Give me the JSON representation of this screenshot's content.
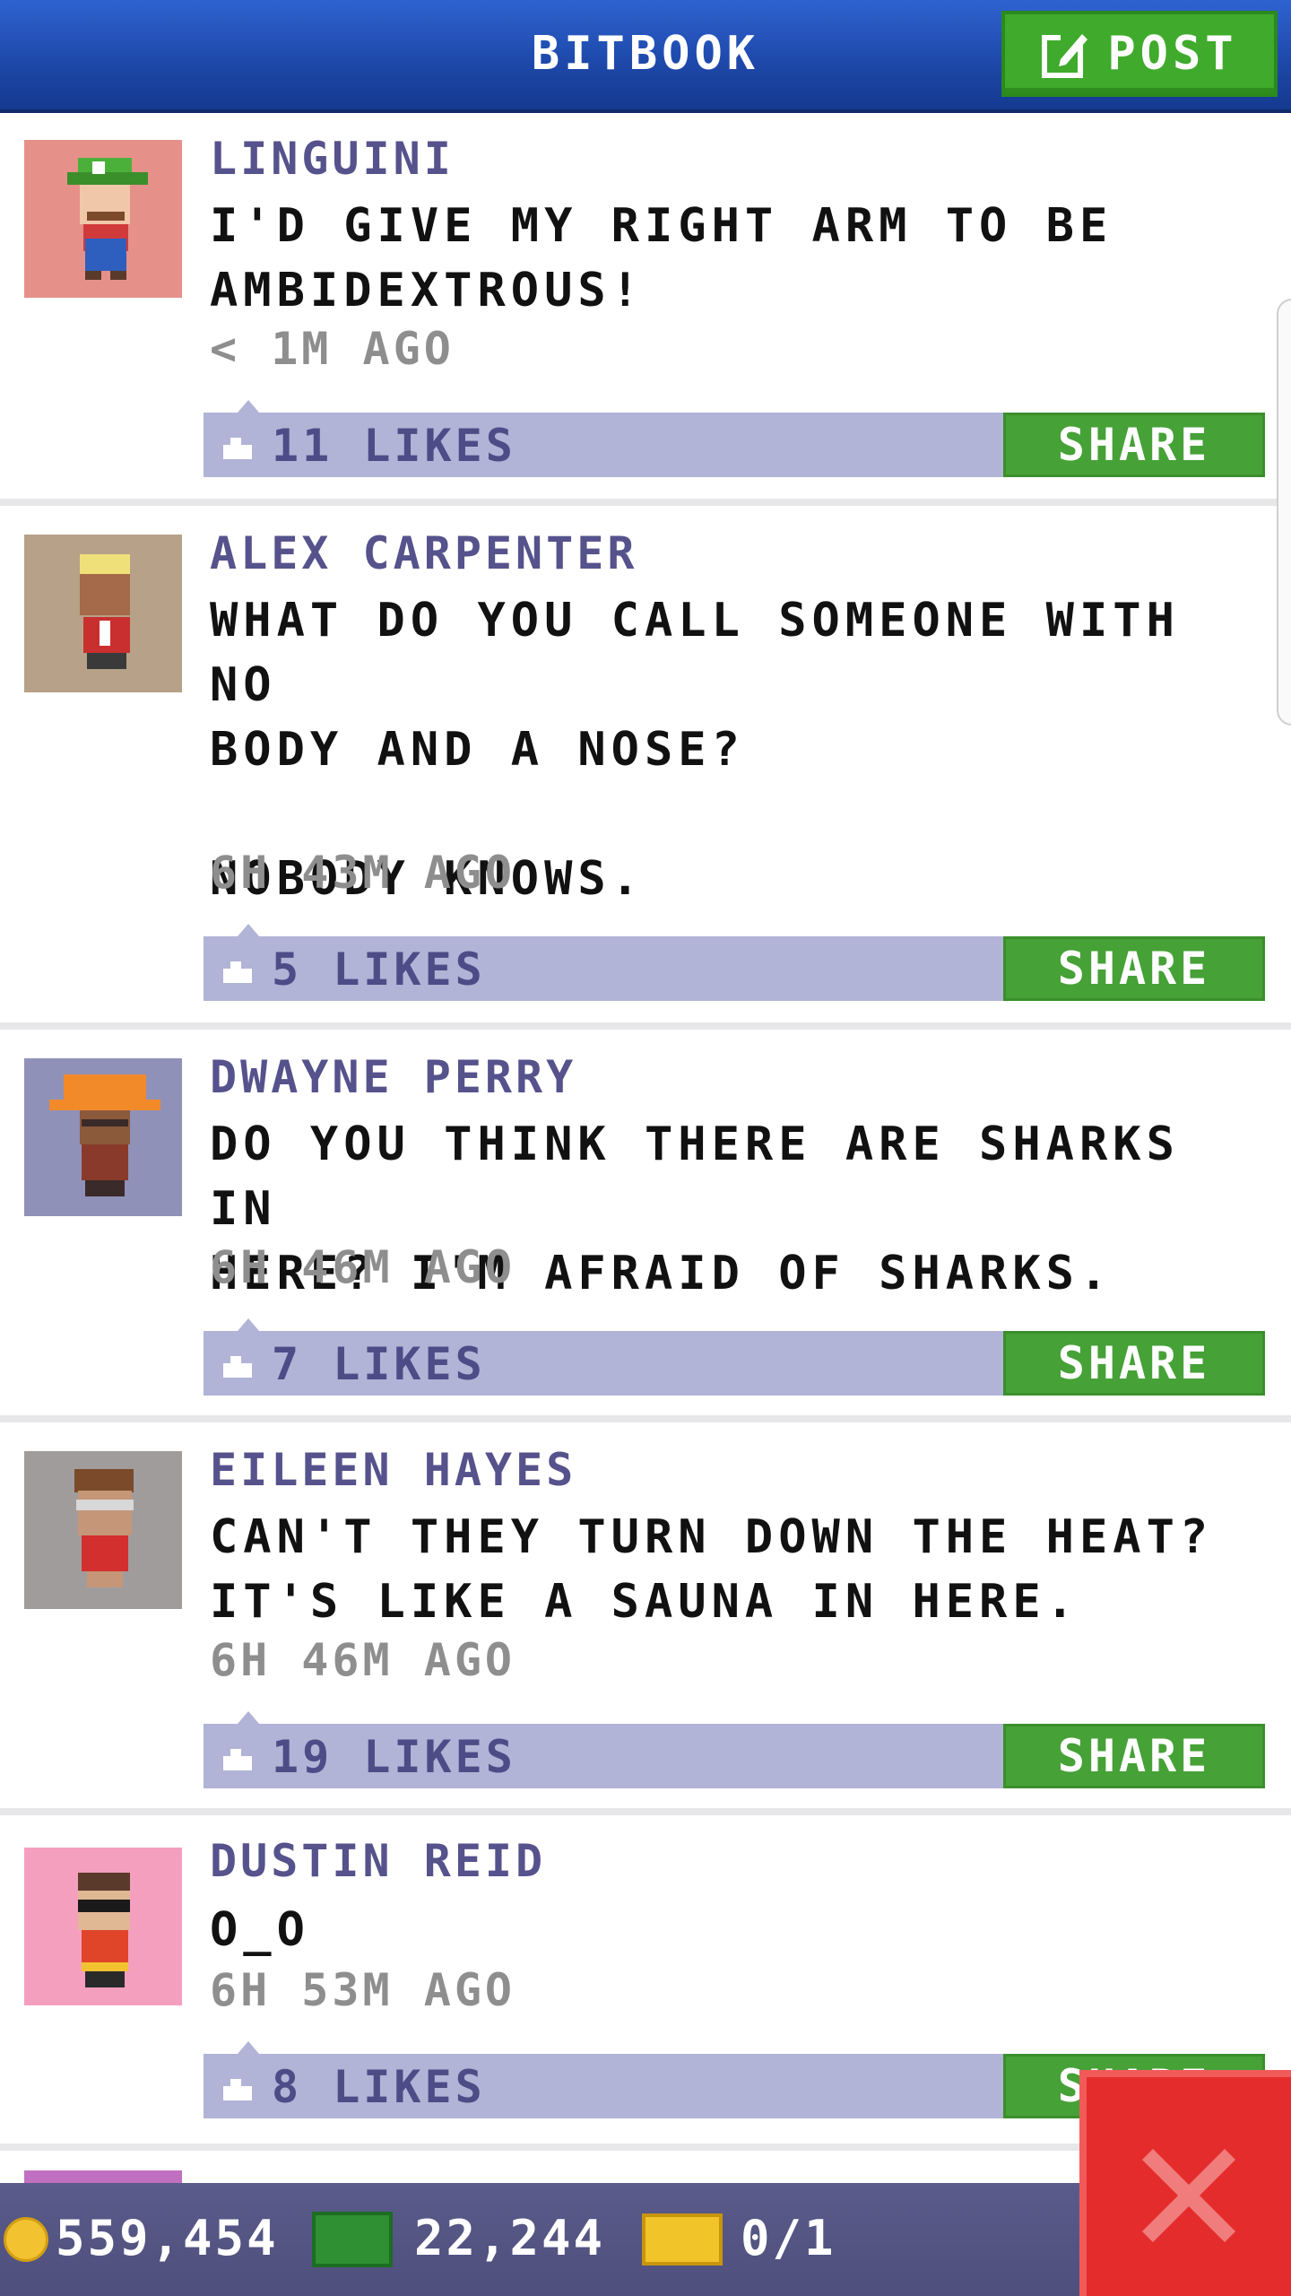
{
  "header": {
    "title": "BITBOOK",
    "post_label": "POST"
  },
  "posts": [
    {
      "author": "LINGUINI",
      "text": "I'D GIVE MY RIGHT ARM TO BE\nAMBIDEXTROUS!",
      "time": "< 1M AGO",
      "likes": "11 LIKES",
      "share_label": "SHARE",
      "avatar_bg": "#e5918a"
    },
    {
      "author": "ALEX CARPENTER",
      "text": "WHAT DO YOU CALL SOMEONE WITH NO\nBODY AND A NOSE?\n\nNOBODY KNOWS.",
      "time": "6H 43M AGO",
      "likes": "5 LIKES",
      "share_label": "SHARE",
      "avatar_bg": "#b7a188"
    },
    {
      "author": "DWAYNE PERRY",
      "text": "DO YOU THINK THERE ARE SHARKS IN\nHERE? I'M AFRAID OF SHARKS.",
      "time": "6H 46M AGO",
      "likes": "7 LIKES",
      "share_label": "SHARE",
      "avatar_bg": "#9091b8"
    },
    {
      "author": "EILEEN HAYES",
      "text": "CAN'T THEY TURN DOWN THE HEAT?\nIT'S LIKE A SAUNA IN HERE.",
      "time": "6H 46M AGO",
      "likes": "19 LIKES",
      "share_label": "SHARE",
      "avatar_bg": "#a09c9c"
    },
    {
      "author": "DUSTIN REID",
      "text": "O_O",
      "time": "6H 53M AGO",
      "likes": "8 LIKES",
      "share_label": "SHARE",
      "avatar_bg": "#f59fbe"
    }
  ],
  "footer": {
    "coins": "559,454",
    "bux": "22,244",
    "tickets": "0/1"
  },
  "colors": {
    "header_blue": "#1d47a8",
    "share_green": "#46a137",
    "like_bar": "#b1b4d6",
    "close_red": "#e52c2c"
  }
}
